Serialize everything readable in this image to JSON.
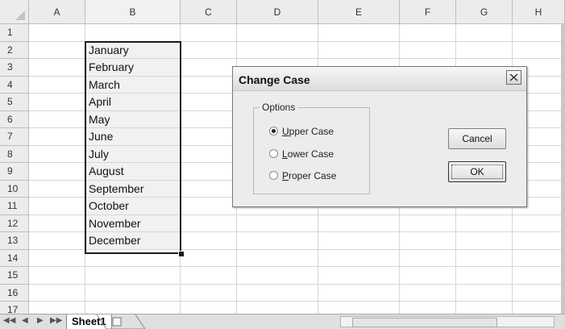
{
  "columns": [
    "A",
    "B",
    "C",
    "D",
    "E",
    "F",
    "G",
    "H"
  ],
  "rows": [
    "1",
    "2",
    "3",
    "4",
    "5",
    "6",
    "7",
    "8",
    "9",
    "10",
    "11",
    "12",
    "13",
    "14",
    "15",
    "16",
    "17"
  ],
  "months": [
    "January",
    "February",
    "March",
    "April",
    "May",
    "June",
    "July",
    "August",
    "September",
    "October",
    "November",
    "December"
  ],
  "sheet_tab": "Sheet1",
  "dialog": {
    "title": "Change Case",
    "close_icon": "close-icon",
    "options_label": "Options",
    "options": [
      {
        "accesskey": "U",
        "rest": "pper Case",
        "selected": true
      },
      {
        "accesskey": "L",
        "rest": "ower Case",
        "selected": false
      },
      {
        "accesskey": "P",
        "rest": "roper Case",
        "selected": false
      }
    ],
    "cancel_label": "Cancel",
    "ok_label": "OK"
  }
}
